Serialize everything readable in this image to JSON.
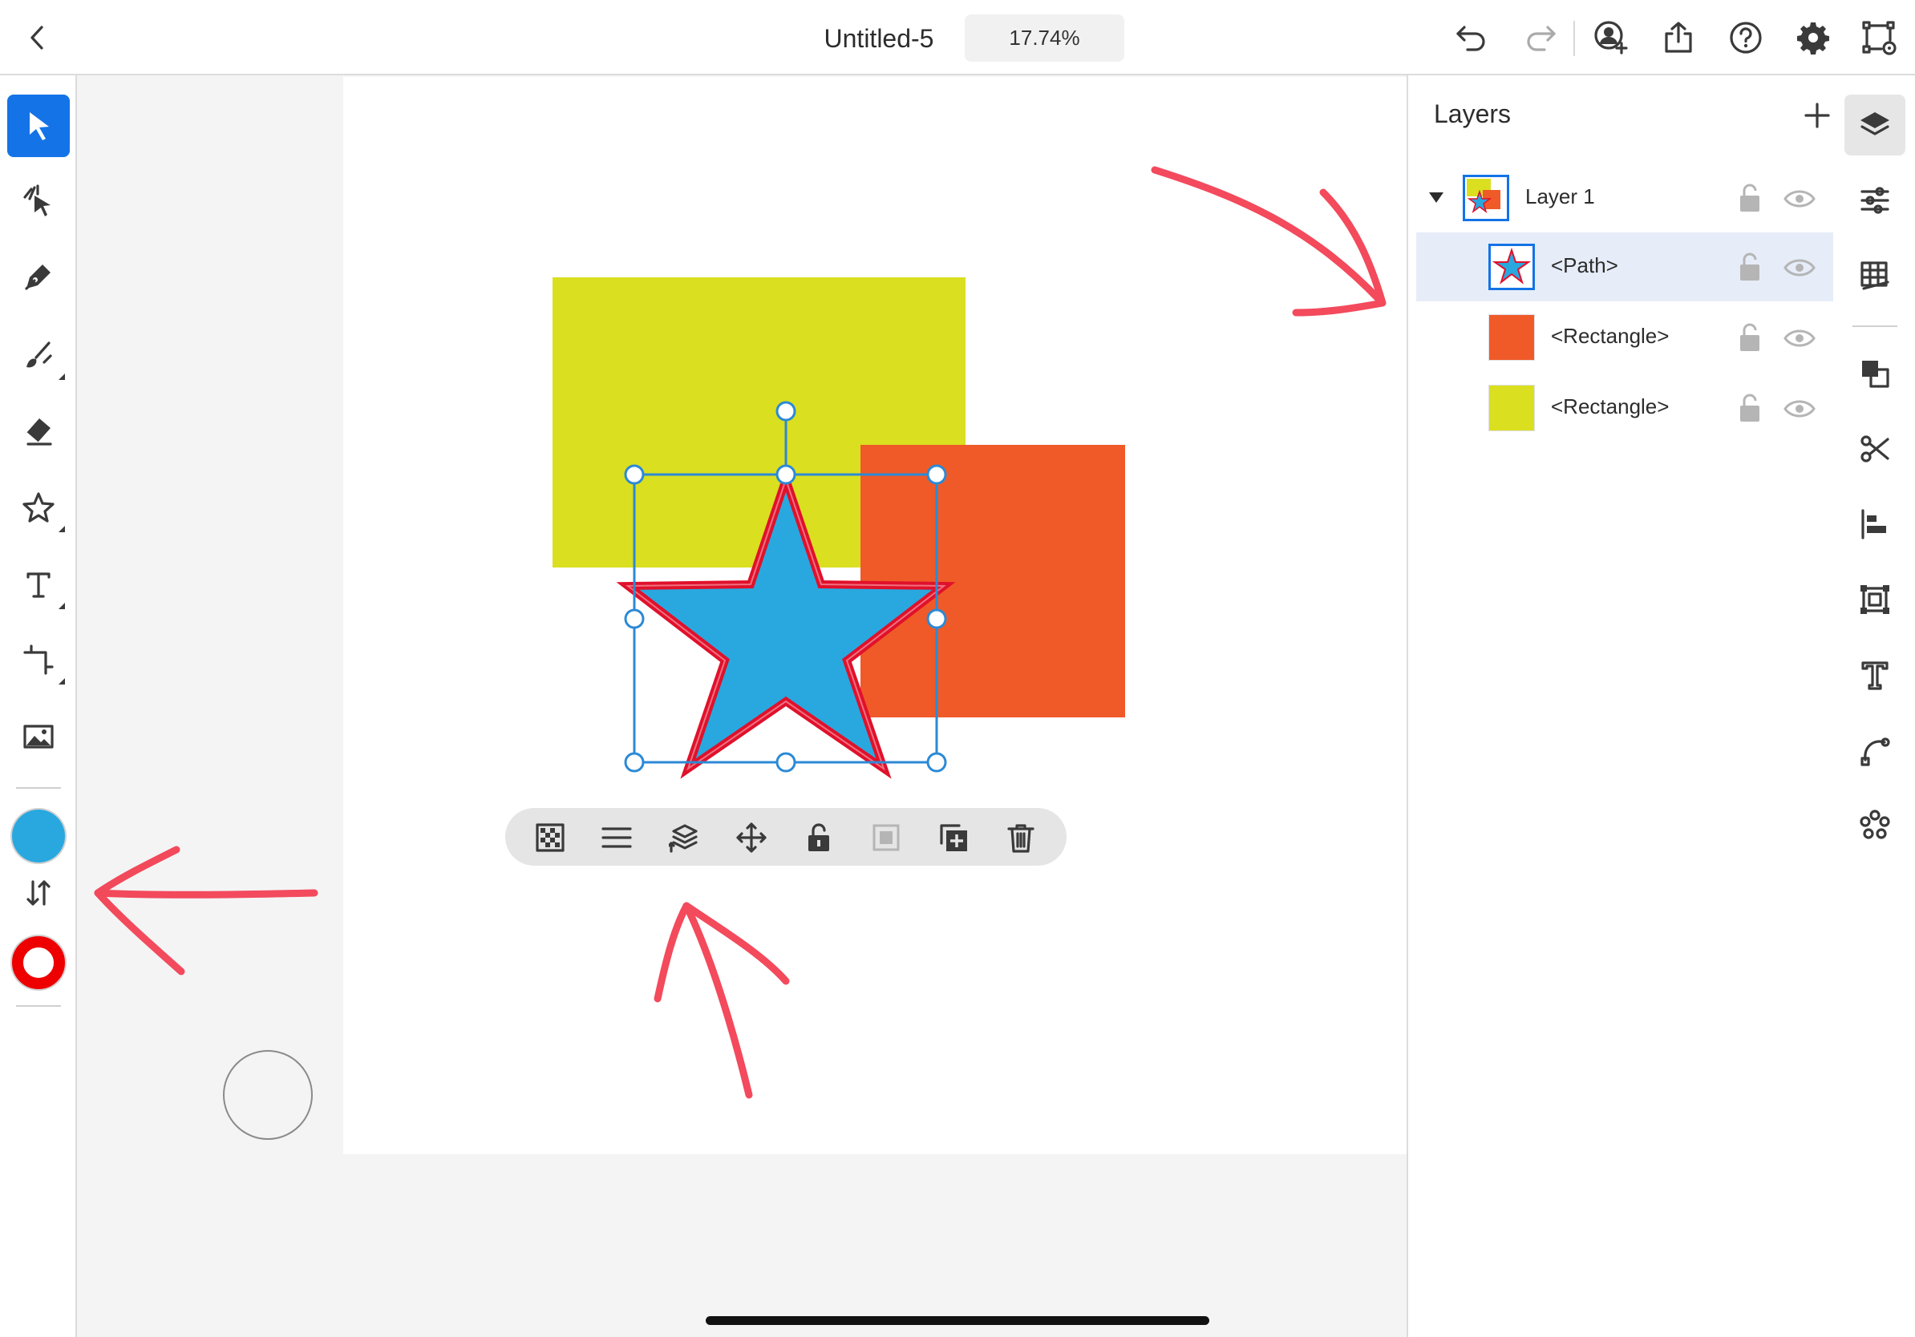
{
  "app": {
    "document_title": "Untitled-5",
    "zoom": "17.74%"
  },
  "layers_panel": {
    "title": "Layers",
    "layers": [
      {
        "name": "Layer 1",
        "expanded": true,
        "locked": false,
        "visible": true
      },
      {
        "name": "<Path>",
        "selected": true,
        "locked": false,
        "visible": true
      },
      {
        "name": "<Rectangle>",
        "color": "#f05a28",
        "locked": false,
        "visible": true
      },
      {
        "name": "<Rectangle>",
        "color": "#dadf20",
        "locked": false,
        "visible": true
      }
    ]
  },
  "tools": {
    "active": "selection-tool",
    "fill_color": "#29a8e0",
    "stroke_color": "#ee0000"
  },
  "canvas": {
    "shapes": [
      {
        "type": "rectangle",
        "color": "#dadf20"
      },
      {
        "type": "rectangle",
        "color": "#f05a28"
      },
      {
        "type": "star",
        "fill": "#29a8e0",
        "stroke": "#e0112b"
      }
    ]
  },
  "colors": {
    "accent": "#1473e6",
    "annotation": "#f23b4f",
    "selection": "#2b8ad6"
  }
}
